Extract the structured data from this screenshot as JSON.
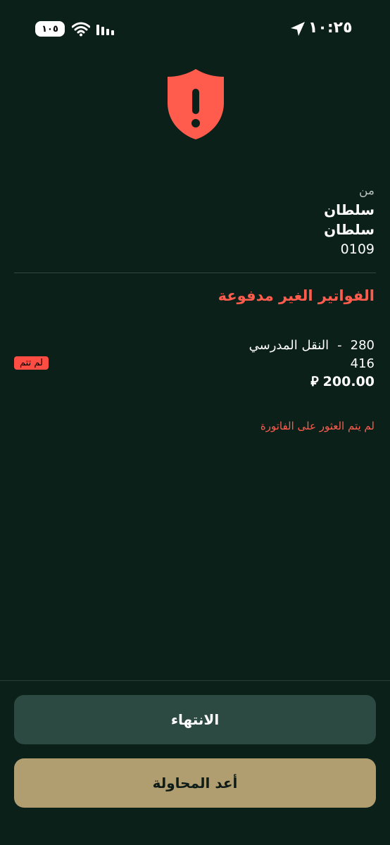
{
  "status_bar": {
    "time": "١٠:٢٥",
    "battery": "١٠٥"
  },
  "icons": {
    "alert": "shield-exclamation-icon"
  },
  "colors": {
    "background": "#0b2019",
    "accent_red": "#ff5c4d",
    "primary_button": "#2c4a42",
    "secondary_button": "#b09e71"
  },
  "from": {
    "label": "من",
    "name_line1": "سلطان",
    "name_line2": "سلطان",
    "account": "0109"
  },
  "unpaid": {
    "title": "الفواتير الغير مدفوعة",
    "item": {
      "code": "280",
      "dash": "-",
      "service": "النقل المدرسي",
      "reference": "416",
      "amount": "200.00",
      "currency": "⃁",
      "status": "لم تتم"
    },
    "error": "لم يتم العثور على الفاتورة"
  },
  "actions": {
    "finish": "الانتهاء",
    "retry": "أعد المحاولة"
  }
}
